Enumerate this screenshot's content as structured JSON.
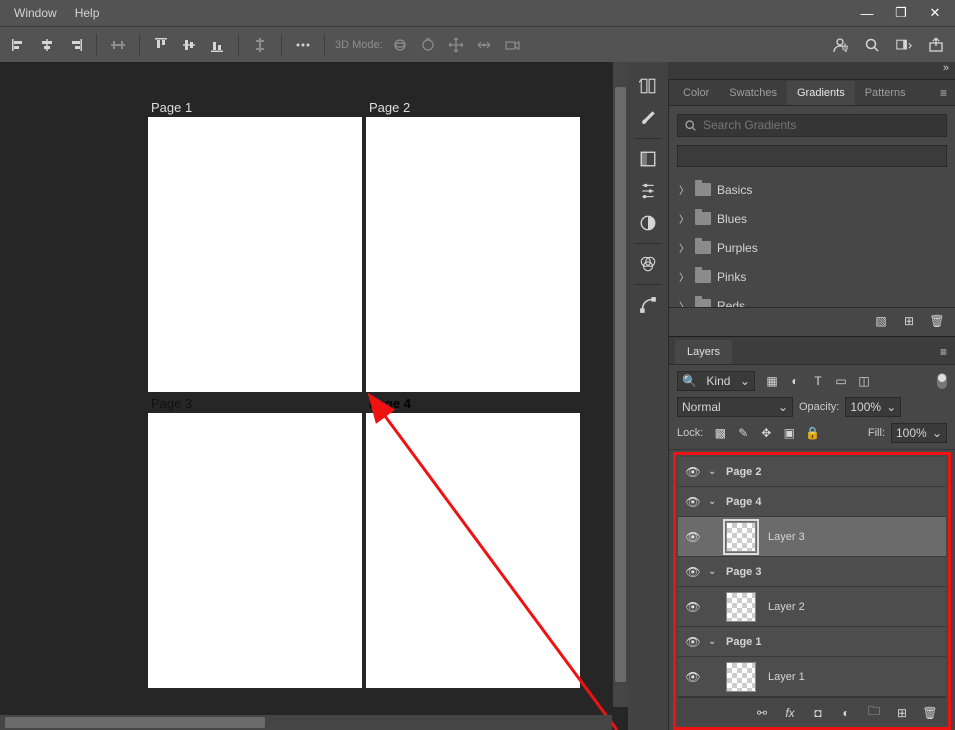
{
  "menu": {
    "window": "Window",
    "help": "Help"
  },
  "mode3d": "3D Mode:",
  "tabs": {
    "color": "Color",
    "swatches": "Swatches",
    "gradients": "Gradients",
    "patterns": "Patterns"
  },
  "search": {
    "placeholder": "Search Gradients"
  },
  "folders": [
    "Basics",
    "Blues",
    "Purples",
    "Pinks",
    "Reds"
  ],
  "layersTab": "Layers",
  "kind": "Kind",
  "blend": "Normal",
  "opacityLabel": "Opacity:",
  "opacityVal": "100%",
  "lockLabel": "Lock:",
  "fillLabel": "Fill:",
  "fillVal": "100%",
  "pages": {
    "p1": "Page 1",
    "p2": "Page 2",
    "p3": "Page 3",
    "p4": "Page 4"
  },
  "layers": {
    "p2": "Page 2",
    "p4": "Page 4",
    "l3": "Layer 3",
    "p3g": "Page 3",
    "l2": "Layer 2",
    "p1g": "Page 1",
    "l1": "Layer 1"
  }
}
